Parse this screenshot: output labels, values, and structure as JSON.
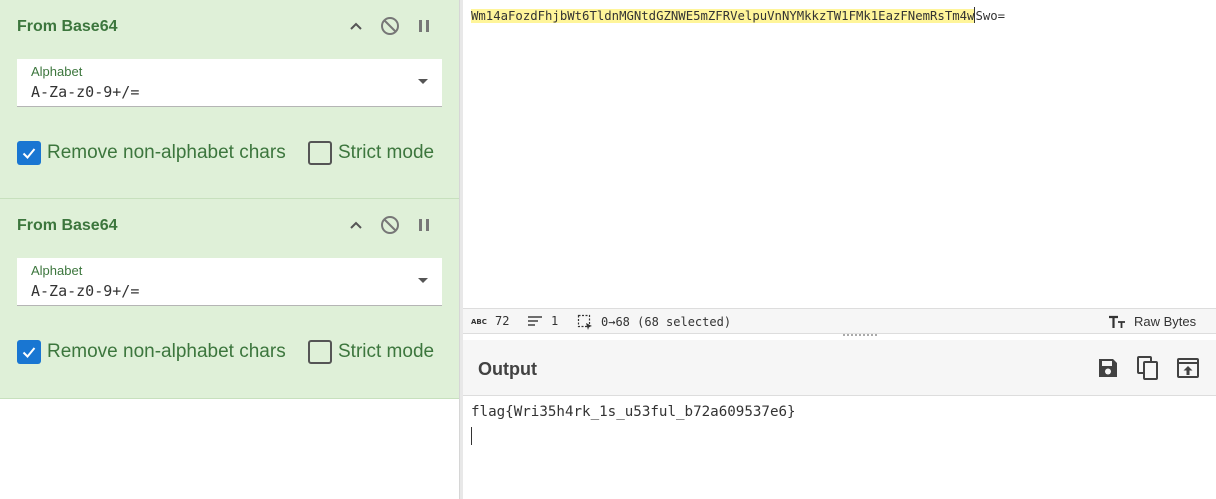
{
  "recipe": {
    "operations": [
      {
        "title": "From Base64",
        "alphabet_label": "Alphabet",
        "alphabet_value": "A-Za-z0-9+/=",
        "remove_nonalpha_label": "Remove non-alphabet chars",
        "remove_nonalpha_checked": true,
        "strict_mode_label": "Strict mode",
        "strict_mode_checked": false
      },
      {
        "title": "From Base64",
        "alphabet_label": "Alphabet",
        "alphabet_value": "A-Za-z0-9+/=",
        "remove_nonalpha_label": "Remove non-alphabet chars",
        "remove_nonalpha_checked": true,
        "strict_mode_label": "Strict mode",
        "strict_mode_checked": false
      }
    ]
  },
  "input": {
    "selected_text": "Wm14aFozdFhjbWt6TldnMGNtdGZNWE5mZFRVelpuVnNYMkkzTW1FMk1EazFNemRsTm4w",
    "unselected_text": "Swo="
  },
  "status": {
    "char_count": "72",
    "line_count": "1",
    "selection": "0→68 (68 selected)",
    "encoding": "Raw Bytes"
  },
  "output": {
    "title": "Output",
    "text": "flag{Wri35h4rk_1s_u53ful_b72a609537e6}"
  },
  "colors": {
    "op_background": "#dff0d8",
    "op_text": "#3c763d",
    "checkbox_accent": "#1976d2",
    "selection_highlight": "#fff59a"
  }
}
